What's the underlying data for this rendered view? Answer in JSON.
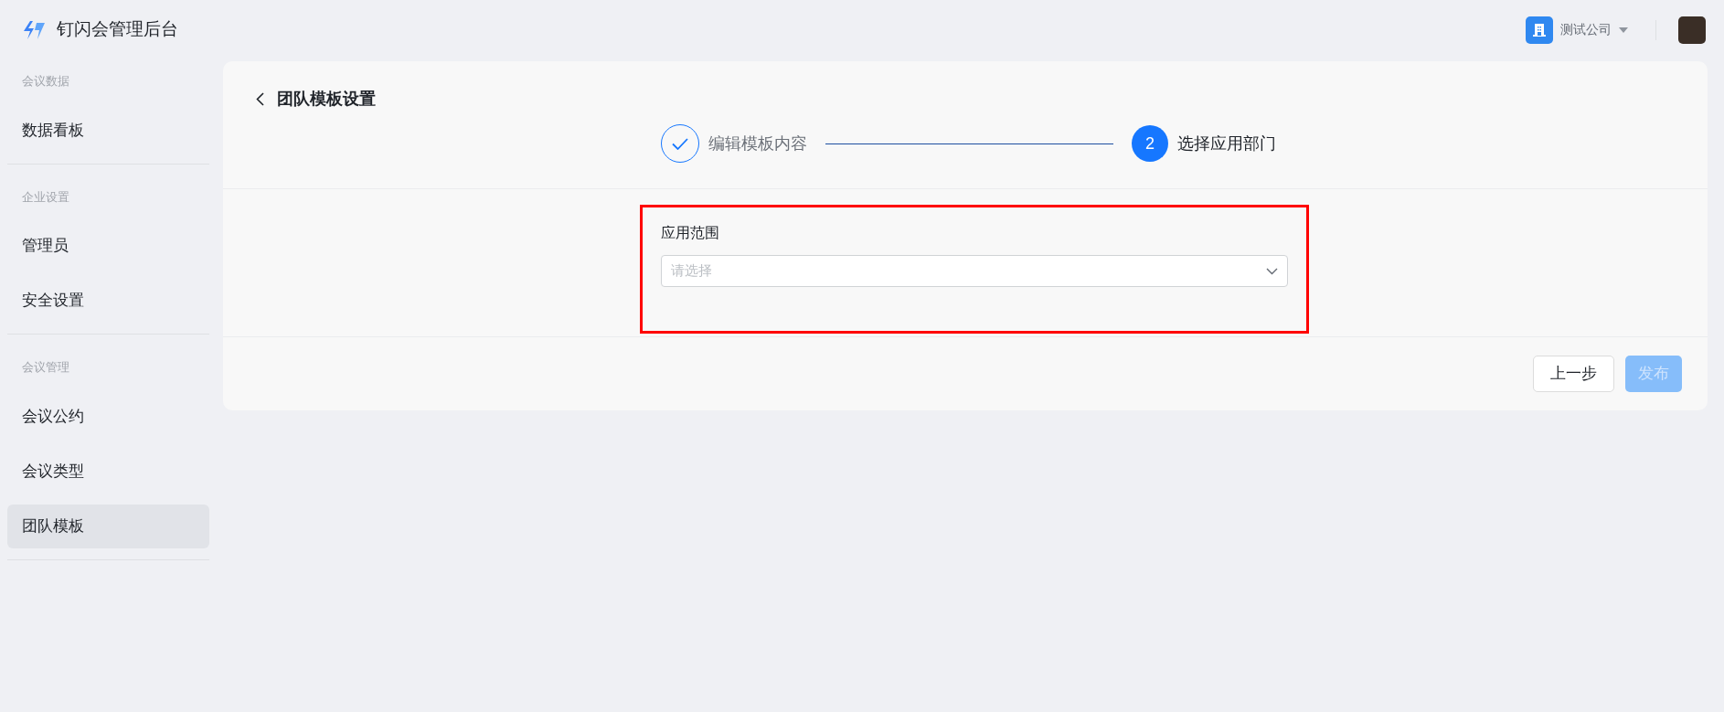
{
  "header": {
    "title": "钉闪会管理后台",
    "company": {
      "name": "测试公司"
    }
  },
  "sidebar": {
    "groups": [
      {
        "label": "会议数据",
        "items": [
          {
            "label": "数据看板",
            "selected": false
          }
        ]
      },
      {
        "label": "企业设置",
        "items": [
          {
            "label": "管理员",
            "selected": false
          },
          {
            "label": "安全设置",
            "selected": false
          }
        ]
      },
      {
        "label": "会议管理",
        "items": [
          {
            "label": "会议公约",
            "selected": false
          },
          {
            "label": "会议类型",
            "selected": false
          },
          {
            "label": "团队模板",
            "selected": true
          }
        ]
      }
    ]
  },
  "page": {
    "title": "团队模板设置",
    "steps": [
      {
        "label": "编辑模板内容",
        "completed": true,
        "current": false
      },
      {
        "label": "选择应用部门",
        "completed": false,
        "current": true,
        "number": "2"
      }
    ],
    "form": {
      "highlighted": true,
      "field": {
        "label": "应用范围",
        "placeholder": "请选择"
      }
    },
    "buttons": [
      {
        "label": "上一步",
        "kind": "default",
        "disabled": false
      },
      {
        "label": "发布",
        "kind": "primary",
        "disabled": true
      }
    ]
  }
}
